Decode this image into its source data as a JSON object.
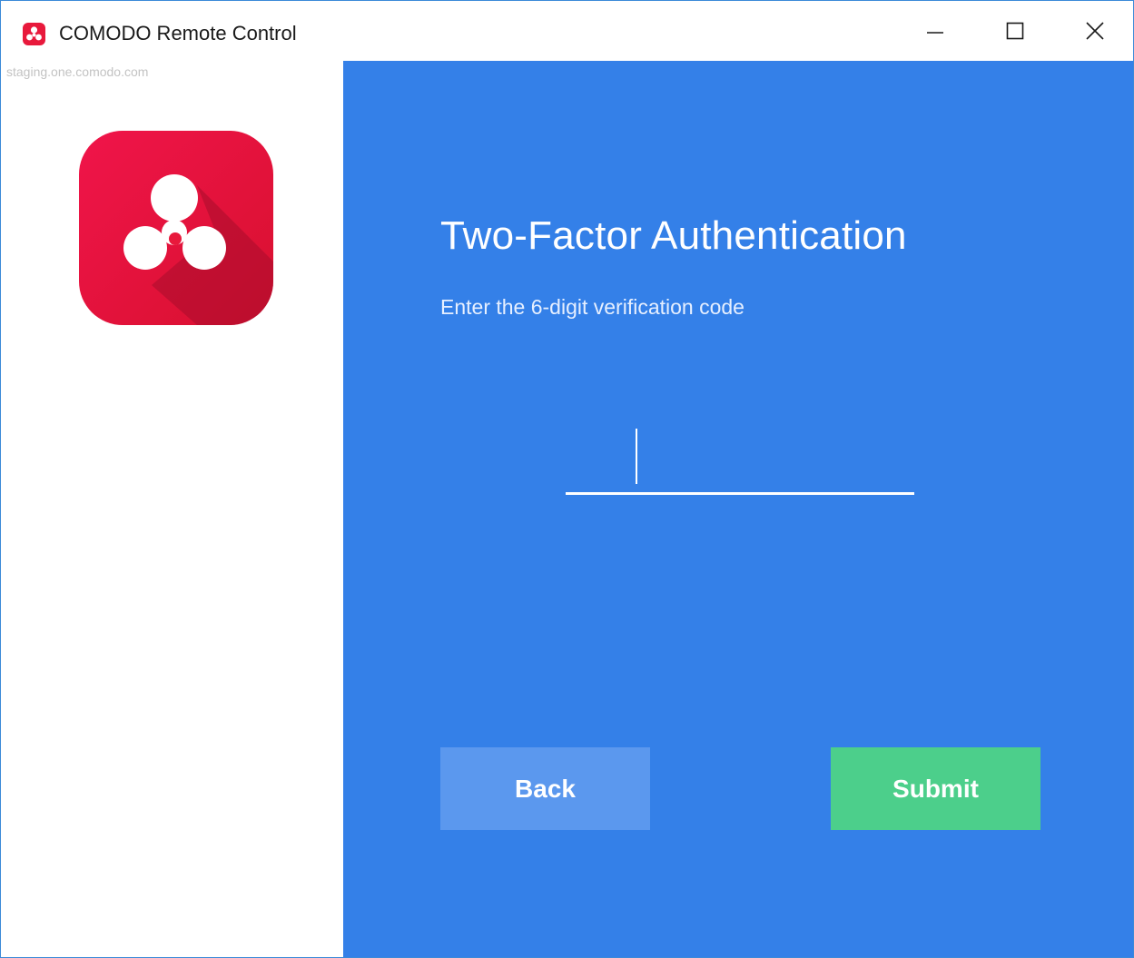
{
  "window": {
    "title": "COMODO Remote Control",
    "subtitle": "staging.one.comodo.com",
    "controls": {
      "minimize_icon": "minimize-icon",
      "maximize_icon": "maximize-icon",
      "close_icon": "close-icon"
    }
  },
  "left_panel": {
    "logo_icon": "comodo-remote-control-logo"
  },
  "main": {
    "heading": "Two-Factor Authentication",
    "instructions": "Enter the 6-digit verification code",
    "code_input": {
      "value": "",
      "placeholder": ""
    },
    "back_label": "Back",
    "submit_label": "Submit"
  },
  "colors": {
    "panel_blue": "#3480e8",
    "back_button": "#5b98ee",
    "submit_button": "#4ccf8b",
    "logo_red": "#e8193c"
  }
}
